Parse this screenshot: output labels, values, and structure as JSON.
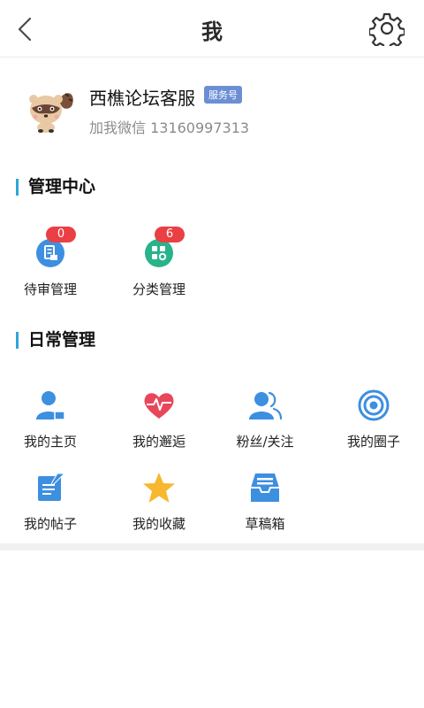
{
  "header": {
    "title": "我"
  },
  "profile": {
    "name": "西樵论坛客服",
    "badge": "服务号",
    "subtitle": "加我微信 13160997313"
  },
  "admin": {
    "title": "管理中心",
    "items": [
      {
        "label": "待审管理",
        "count": "0",
        "icon": "pending-review-icon"
      },
      {
        "label": "分类管理",
        "count": "6",
        "icon": "category-icon"
      }
    ]
  },
  "daily": {
    "title": "日常管理",
    "items": [
      {
        "label": "我的主页",
        "icon": "user-home-icon"
      },
      {
        "label": "我的邂逅",
        "icon": "heart-pulse-icon"
      },
      {
        "label": "粉丝/关注",
        "icon": "fans-icon"
      },
      {
        "label": "我的圈子",
        "icon": "circle-icon"
      },
      {
        "label": "我的帖子",
        "icon": "post-edit-icon"
      },
      {
        "label": "我的收藏",
        "icon": "star-icon"
      },
      {
        "label": "草稿箱",
        "icon": "drafts-inbox-icon"
      }
    ]
  },
  "colors": {
    "accent_blue": "#3d8fe0",
    "badge_red": "#ea3f44",
    "heart_red": "#e8475a",
    "star_yellow": "#f7b82f",
    "category_green": "#28b38a",
    "section_bar": "#2fa5d8"
  }
}
